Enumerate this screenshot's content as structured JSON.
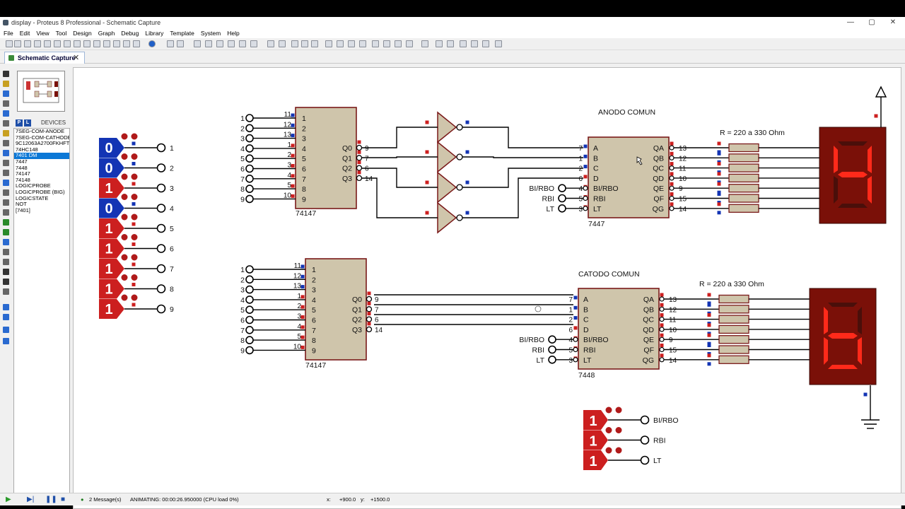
{
  "window": {
    "title": "display - Proteus 8 Professional - Schematic Capture",
    "min": "—",
    "max": "▢",
    "close": "✕"
  },
  "menu": [
    "File",
    "Edit",
    "View",
    "Tool",
    "Design",
    "Graph",
    "Debug",
    "Library",
    "Template",
    "System",
    "Help"
  ],
  "tab": {
    "label": "Schematic Capture",
    "close": "✕"
  },
  "device_panel": {
    "p": "P",
    "l": "L",
    "header": "DEVICES",
    "items": [
      "7SEG-COM-ANODE",
      "7SEG-COM-CATHODE",
      "9C12063A2700FKHFT",
      "74HC148",
      "7401 DM",
      "7447",
      "7448",
      "74147",
      "74148",
      "LOGICPROBE",
      "LOGICPROBE (BIG)",
      "LOGICSTATE",
      "NOT",
      "[7401]"
    ],
    "selected_index": 4
  },
  "status": {
    "messages": "2 Message(s)",
    "animating": "ANIMATING: 00:00:26.950000 (CPU load 0%)",
    "x_label": "x:",
    "x": "+900.0",
    "y_label": "y:",
    "y": "+1500.0"
  },
  "schematic": {
    "colors": {
      "wire": "#000000",
      "chip_fill": "#cfc5ab",
      "chip_border": "#7a1a1a",
      "high": "#cc1f1f",
      "low": "#1334b4",
      "seg_on": "#ff2a1a",
      "seg_off": "#4a0f0a",
      "seg_bg": "#7a1008"
    },
    "logicstates": [
      {
        "v": "0",
        "pin": "1"
      },
      {
        "v": "0",
        "pin": "2"
      },
      {
        "v": "1",
        "pin": "3"
      },
      {
        "v": "0",
        "pin": "4"
      },
      {
        "v": "1",
        "pin": "5"
      },
      {
        "v": "1",
        "pin": "6"
      },
      {
        "v": "1",
        "pin": "7"
      },
      {
        "v": "1",
        "pin": "8"
      },
      {
        "v": "1",
        "pin": "9"
      }
    ],
    "enc_top": {
      "name": "74147",
      "in_pins": [
        "11",
        "12",
        "13",
        "1",
        "2",
        "3",
        "4",
        "5",
        "10"
      ],
      "in_labels": [
        "1",
        "2",
        "3",
        "4",
        "5",
        "6",
        "7",
        "8",
        "9"
      ],
      "inputs_left": [
        "1",
        "2",
        "3",
        "4",
        "5",
        "6",
        "7",
        "8",
        "9"
      ],
      "out_labels": [
        "Q0",
        "Q1",
        "Q2",
        "Q3"
      ],
      "out_pins": [
        "9",
        "7",
        "6",
        "14"
      ]
    },
    "enc_bot": {
      "name": "74147",
      "in_pins": [
        "11",
        "12",
        "13",
        "1",
        "2",
        "3",
        "4",
        "5",
        "10"
      ],
      "in_labels": [
        "1",
        "2",
        "3",
        "4",
        "5",
        "6",
        "7",
        "8",
        "9"
      ],
      "inputs_left": [
        "1",
        "2",
        "3",
        "4",
        "5",
        "6",
        "7",
        "8",
        "9"
      ],
      "out_labels": [
        "Q0",
        "Q1",
        "Q2",
        "Q3"
      ],
      "out_pins": [
        "9",
        "7",
        "6",
        "14"
      ]
    },
    "dec_top": {
      "name": "7447",
      "title": "ANODO COMUN",
      "in_labels": [
        "A",
        "B",
        "C",
        "D",
        "BI/RBO",
        "RBI",
        "LT"
      ],
      "in_pins": [
        "7",
        "1",
        "2",
        "6",
        "4",
        "5",
        "3"
      ],
      "ctrl_labels": [
        "BI/RBO",
        "RBI",
        "LT"
      ],
      "out_labels": [
        "QA",
        "QB",
        "QC",
        "QD",
        "QE",
        "QF",
        "QG"
      ],
      "out_pins": [
        "13",
        "12",
        "11",
        "10",
        "9",
        "15",
        "14"
      ],
      "res_label": "R = 220 a 330 Ohm",
      "digit": "4"
    },
    "dec_bot": {
      "name": "7448",
      "title": "CATODO COMUN",
      "in_labels": [
        "A",
        "B",
        "C",
        "D",
        "BI/RBO",
        "RBI",
        "LT"
      ],
      "in_pins": [
        "7",
        "1",
        "2",
        "6",
        "4",
        "5",
        "3"
      ],
      "ctrl_labels": [
        "BI/RBO",
        "RBI",
        "LT"
      ],
      "out_labels": [
        "QA",
        "QB",
        "QC",
        "QD",
        "QE",
        "QF",
        "QG"
      ],
      "out_pins": [
        "13",
        "12",
        "11",
        "10",
        "9",
        "15",
        "14"
      ],
      "res_label": "R = 220 a 330 Ohm",
      "digit": "b"
    },
    "ctrl_states": [
      {
        "v": "1",
        "label": "BI/RBO"
      },
      {
        "v": "1",
        "label": "RBI"
      },
      {
        "v": "1",
        "label": "LT"
      }
    ]
  }
}
